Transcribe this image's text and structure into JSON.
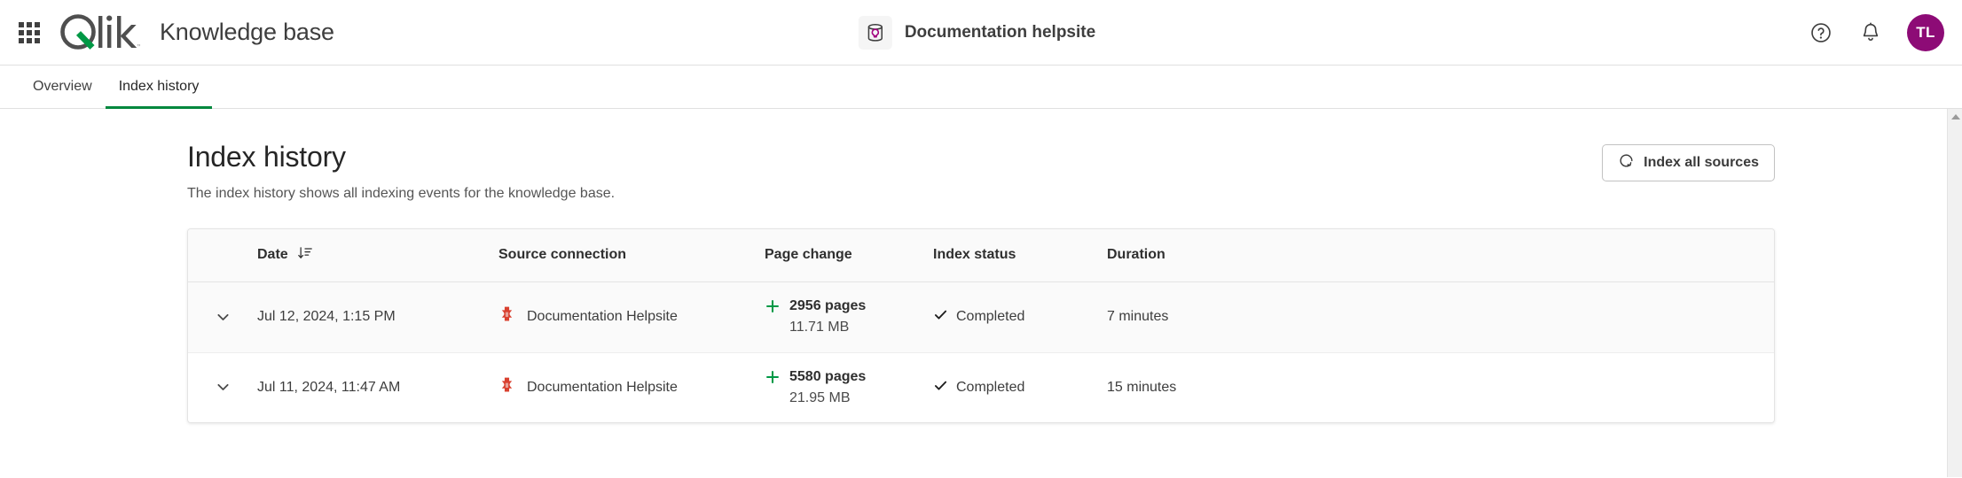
{
  "topbar": {
    "launcher_icon": "app-launcher-grid-icon",
    "brand_logo": "qlik-logo",
    "brand_logo_text": "Qlik",
    "title": "Knowledge base",
    "center_chip": {
      "icon": "knowledge-base-icon",
      "label": "Documentation helpsite"
    },
    "help_icon": "help-circle-icon",
    "notifications_icon": "bell-icon",
    "avatar_initials": "TL",
    "avatar_color": "#8d0b76"
  },
  "tabs": [
    {
      "label": "Overview",
      "active": false
    },
    {
      "label": "Index history",
      "active": true
    }
  ],
  "page": {
    "title": "Index history",
    "subtitle": "The index history shows all indexing events for the knowledge base.",
    "index_all_button": {
      "label": "Index all sources",
      "icon": "reindex-refresh-icon"
    }
  },
  "table": {
    "columns": [
      {
        "key": "expander",
        "label": ""
      },
      {
        "key": "date",
        "label": "Date",
        "sort_icon": "sort-descending-icon"
      },
      {
        "key": "source",
        "label": "Source connection"
      },
      {
        "key": "page_change",
        "label": "Page change"
      },
      {
        "key": "status",
        "label": "Index status"
      },
      {
        "key": "duration",
        "label": "Duration"
      }
    ],
    "rows": [
      {
        "expander_icon": "chevron-down-icon",
        "date": "Jul 12, 2024, 1:15 PM",
        "source_icon": "source-connection-icon",
        "source": "Documentation Helpsite",
        "page_change_icon": "plus-icon",
        "pages": "2956 pages",
        "size": "11.71 MB",
        "status_icon": "check-icon",
        "status": "Completed",
        "duration": "7 minutes"
      },
      {
        "expander_icon": "chevron-down-icon",
        "date": "Jul 11, 2024, 11:47 AM",
        "source_icon": "source-connection-icon",
        "source": "Documentation Helpsite",
        "page_change_icon": "plus-icon",
        "pages": "5580 pages",
        "size": "21.95 MB",
        "status_icon": "check-icon",
        "status": "Completed",
        "duration": "15 minutes"
      }
    ]
  },
  "colors": {
    "accent_green": "#00873d",
    "plus_green": "#009845",
    "source_icon_red": "#d9402f",
    "avatar_magenta": "#8d0b76"
  },
  "scrollbar": {
    "up_arrow_icon": "scroll-up-arrow-icon"
  }
}
